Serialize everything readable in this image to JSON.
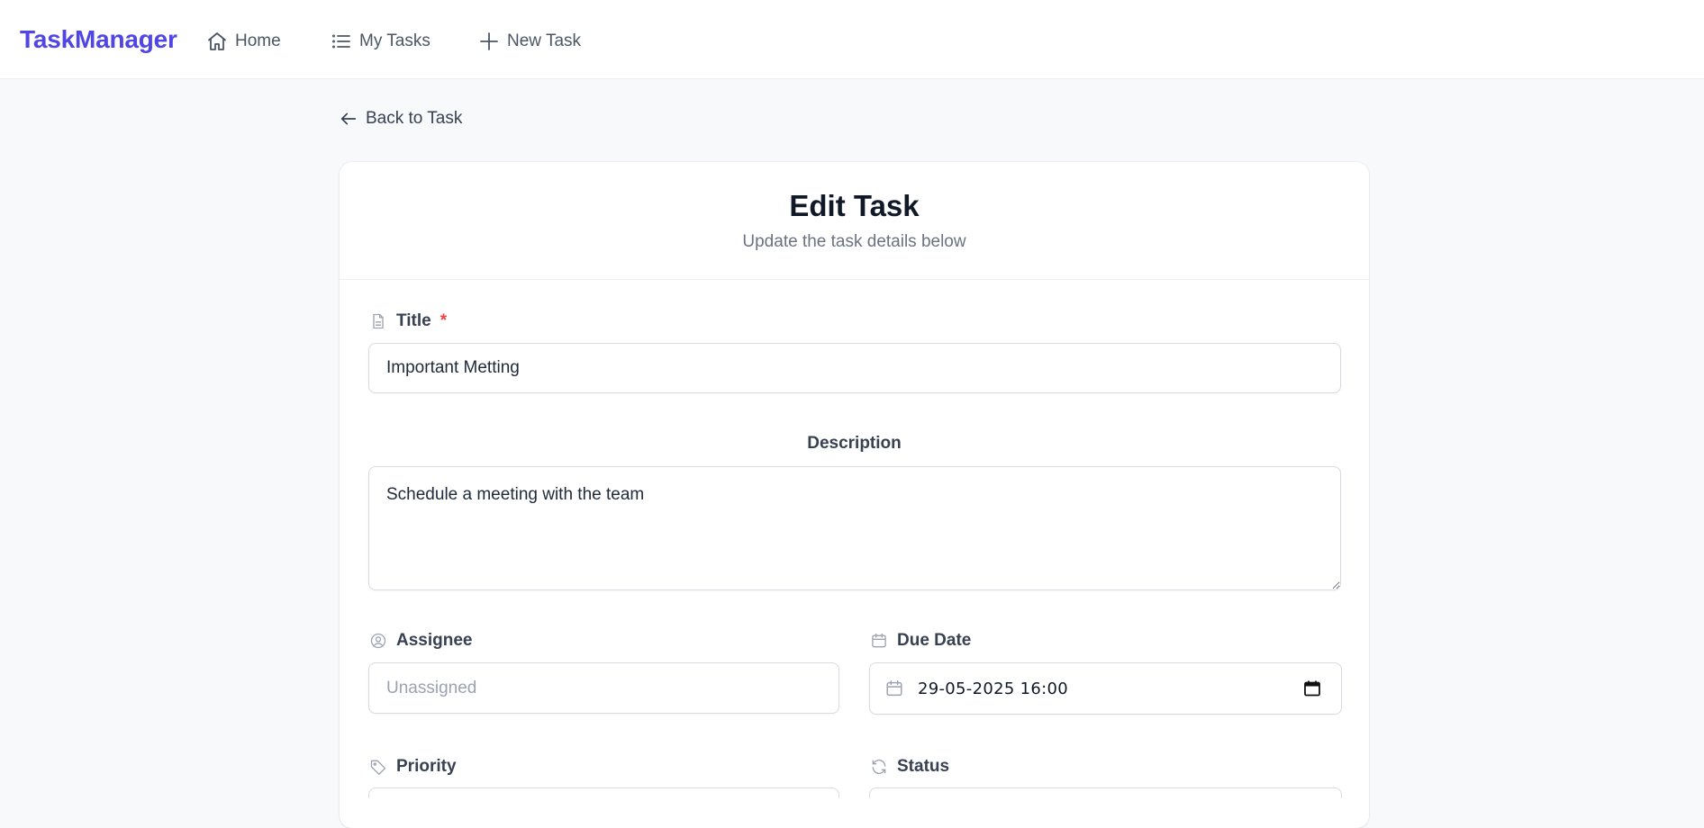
{
  "nav": {
    "brand": "TaskManager",
    "home": "Home",
    "my_tasks": "My Tasks",
    "new_task": "New Task"
  },
  "back_link": "Back to Task",
  "form": {
    "heading": "Edit Task",
    "subheading": "Update the task details below",
    "title_label": "Title",
    "required_mark": "*",
    "title_value": "Important Metting",
    "description_label": "Description",
    "description_value": "Schedule a meeting with the team",
    "assignee_label": "Assignee",
    "assignee_placeholder": "Unassigned",
    "due_date_label": "Due Date",
    "due_date_value": "29-05-2025 16:00",
    "priority_label": "Priority",
    "status_label": "Status"
  },
  "colors": {
    "accent": "#4f46e5",
    "required": "#ef4444",
    "page_bg": "#f8f9fb"
  },
  "icons": {
    "home": "home-icon",
    "tasks": "list-icon",
    "new": "plus-icon",
    "back": "arrow-left-icon",
    "title": "document-icon",
    "assignee": "user-circle-icon",
    "due_date": "calendar-icon",
    "priority": "tag-icon",
    "status": "refresh-icon"
  }
}
